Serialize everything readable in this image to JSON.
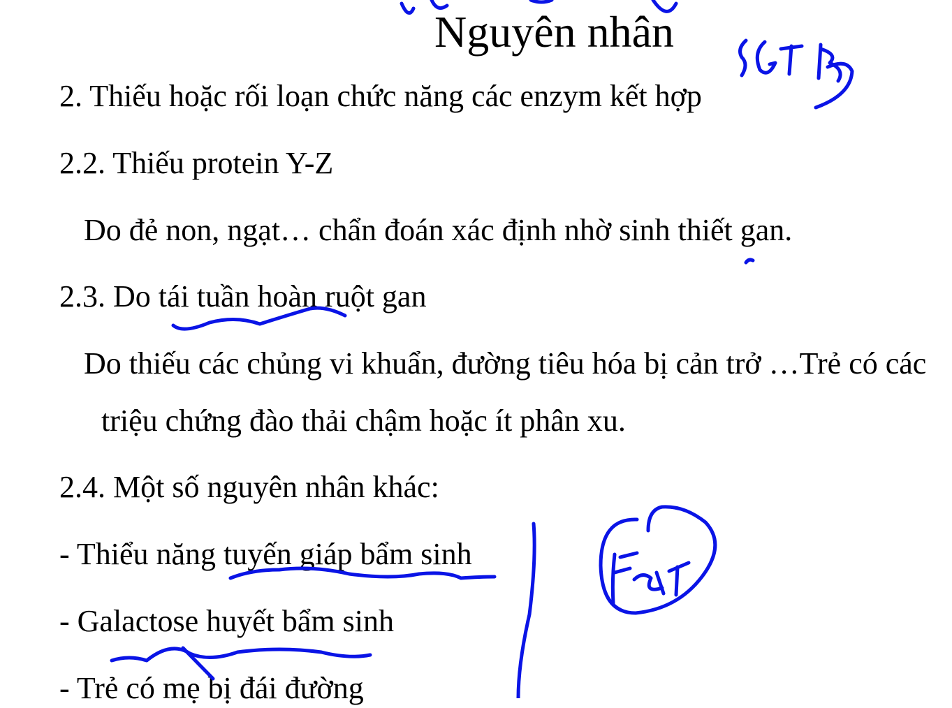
{
  "slide": {
    "title": "Nguyên nhân",
    "lines": [
      "2. Thiếu hoặc rối loạn chức năng các enzym kết hợp",
      "2.2. Thiếu protein Y-Z",
      "Do đẻ non, ngạt… chẩn đoán xác định nhờ sinh thiết gan.",
      "2.3. Do tái tuần hoàn ruột gan",
      "Do thiếu các chủng vi khuẩn, đường tiêu hóa bị cản trở …Trẻ có các",
      "triệu chứng đào thải chậm hoặc ít phân xu.",
      "2.4. Một số nguyên nhân khác:",
      "- Thiểu năng tuyến giáp bẩm sinh",
      "- Galactose huyết bẩm sinh",
      "- Trẻ có mẹ bị đái đường"
    ]
  },
  "annotations": {
    "ink_color": "#0a14e6",
    "notes": [
      "SGT B3"
    ]
  }
}
